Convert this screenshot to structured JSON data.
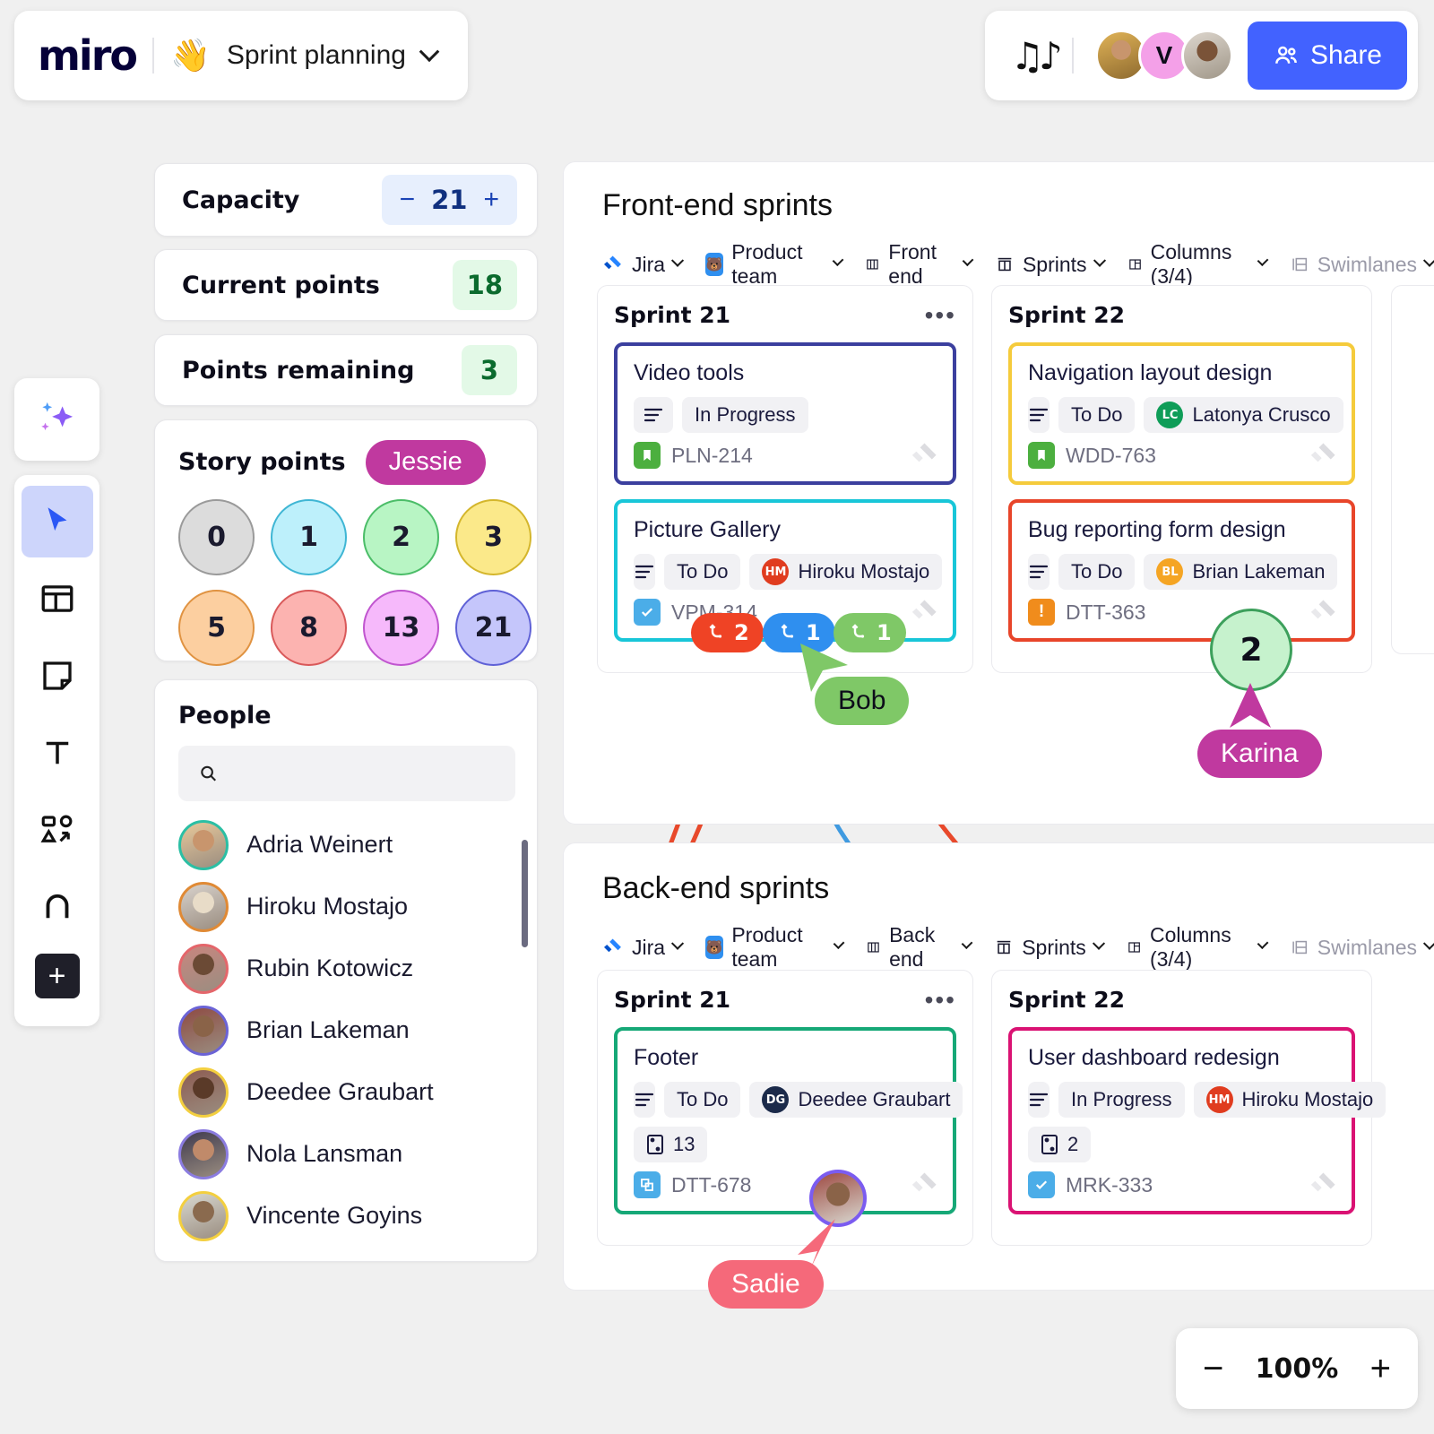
{
  "header": {
    "logo": "miro",
    "wave_icon": "waving-hand-icon",
    "board_title": "Sprint planning",
    "chevron_icon": "chevron-down-icon",
    "music_icon": "music-notes-icon",
    "avatar_initial": "V",
    "share_label": "Share",
    "share_icon": "people-icon",
    "share_color": "#4262ff"
  },
  "toolbar": {
    "ai_icon": "sparkle-icon",
    "tools": [
      {
        "name": "select-tool",
        "icon": "cursor-icon",
        "active": true
      },
      {
        "name": "templates-tool",
        "icon": "layout-icon",
        "active": false
      },
      {
        "name": "sticky-note-tool",
        "icon": "sticky-note-icon",
        "active": false
      },
      {
        "name": "text-tool",
        "icon": "text-t-icon",
        "active": false
      },
      {
        "name": "shapes-tool",
        "icon": "shapes-icon",
        "active": false
      },
      {
        "name": "pen-tool",
        "icon": "pen-icon",
        "active": false
      }
    ],
    "add_label": "+",
    "add_icon": "plus-icon"
  },
  "sidebar": {
    "capacity": {
      "label": "Capacity",
      "value": "21",
      "minus": "−",
      "plus": "+"
    },
    "current_points": {
      "label": "Current points",
      "value": "18"
    },
    "points_remaining": {
      "label": "Points remaining",
      "value": "3"
    },
    "story_points": {
      "title": "Story points",
      "cursor_name": "Jessie",
      "cursor_color": "#c0399f",
      "values": [
        {
          "value": "0",
          "fill": "#dcdcdc",
          "stroke": "#9a9a9a"
        },
        {
          "value": "1",
          "fill": "#bdf0fb",
          "stroke": "#3fb6d4"
        },
        {
          "value": "2",
          "fill": "#b8f5c4",
          "stroke": "#4bbd68"
        },
        {
          "value": "3",
          "fill": "#fbe98a",
          "stroke": "#d4b62c"
        },
        {
          "value": "5",
          "fill": "#fccfa0",
          "stroke": "#e09342"
        },
        {
          "value": "8",
          "fill": "#fcb3b0",
          "stroke": "#d9595a"
        },
        {
          "value": "13",
          "fill": "#f6b9fb",
          "stroke": "#c055cf"
        },
        {
          "value": "21",
          "fill": "#c5c6fb",
          "stroke": "#5f61d6"
        }
      ]
    },
    "people": {
      "title": "People",
      "search_placeholder": "",
      "search_value": "",
      "search_icon": "search-icon",
      "list": [
        {
          "name": "Adria Weinert",
          "ring": "#2bbfa4",
          "skin": "#c8956d",
          "bg": "#e8c89a"
        },
        {
          "name": "Hiroku Mostajo",
          "ring": "#e08a35",
          "skin": "#e8dcc8",
          "bg": "#d8d2cc"
        },
        {
          "name": "Rubin Kotowicz",
          "ring": "#e4666b",
          "skin": "#6b4a35",
          "bg": "#c9867f"
        },
        {
          "name": "Brian Lakeman",
          "ring": "#6b63d6",
          "skin": "#8a6348",
          "bg": "#8e4a42"
        },
        {
          "name": "Deedee Graubart",
          "ring": "#f3cf3f",
          "skin": "#5a3a28",
          "bg": "#8d5c52"
        },
        {
          "name": "Nola Lansman",
          "ring": "#8b7ce0",
          "skin": "#c08a6a",
          "bg": "#3f3a4e"
        },
        {
          "name": "Vincente Goyins",
          "ring": "#f3cf3f",
          "skin": "#8a6a4e",
          "bg": "#d8d8d0"
        }
      ]
    }
  },
  "canvas": {
    "frames": [
      {
        "title": "Front-end sprints",
        "filters": [
          {
            "label": "Jira",
            "icon": "jira-icon",
            "muted": false
          },
          {
            "label": "Product team",
            "icon": "team-icon",
            "muted": false
          },
          {
            "label": "Front end",
            "icon": "board-icon",
            "muted": false
          },
          {
            "label": "Sprints",
            "icon": "sprints-icon",
            "muted": false
          },
          {
            "label": "Columns (3/4)",
            "icon": "columns-icon",
            "muted": false
          },
          {
            "label": "Swimlanes",
            "icon": "swimlanes-icon",
            "muted": true
          }
        ],
        "columns": [
          {
            "title": "Sprint 21",
            "menu_icon": "more-icon",
            "cards": [
              {
                "title": "Video tools",
                "border": "#3b3f9e",
                "status": "In Progress",
                "assignee": null,
                "assignee_initials": null,
                "assignee_color": null,
                "points": null,
                "key": "PLN-214",
                "key_icon": "story-bookmark-icon",
                "key_color": "#4caf3f"
              },
              {
                "title": "Picture Gallery",
                "border": "#18c6d8",
                "status": "To Do",
                "assignee": "Hiroku Mostajo",
                "assignee_initials": "HM",
                "assignee_color": "#e03c1f",
                "points": null,
                "key": "VPM-314",
                "key_icon": "task-check-icon",
                "key_color": "#4bade8"
              }
            ]
          },
          {
            "title": "Sprint 22",
            "menu_icon": "more-icon",
            "cards": [
              {
                "title": "Navigation layout design",
                "border": "#f5cb3c",
                "status": "To Do",
                "assignee": "Latonya Crusco",
                "assignee_initials": "LC",
                "assignee_color": "#0f9d58",
                "points": null,
                "key": "WDD-763",
                "key_icon": "story-bookmark-icon",
                "key_color": "#4caf3f"
              },
              {
                "title": "Bug reporting form design",
                "border": "#e8452a",
                "status": "To Do",
                "assignee": "Brian Lakeman",
                "assignee_initials": "BL",
                "assignee_color": "#f5a524",
                "points": null,
                "key": "DTT-363",
                "key_icon": "bug-alert-icon",
                "key_color": "#f08c1c"
              }
            ]
          }
        ]
      },
      {
        "title": "Back-end sprints",
        "filters": [
          {
            "label": "Jira",
            "icon": "jira-icon",
            "muted": false
          },
          {
            "label": "Product team",
            "icon": "team-icon",
            "muted": false
          },
          {
            "label": "Back end",
            "icon": "board-icon",
            "muted": false
          },
          {
            "label": "Sprints",
            "icon": "sprints-icon",
            "muted": false
          },
          {
            "label": "Columns (3/4)",
            "icon": "columns-icon",
            "muted": false
          },
          {
            "label": "Swimlanes",
            "icon": "swimlanes-icon",
            "muted": true
          }
        ],
        "columns": [
          {
            "title": "Sprint 21",
            "menu_icon": "more-icon",
            "cards": [
              {
                "title": "Footer",
                "border": "#16a877",
                "status": "To Do",
                "assignee": "Deedee Graubart",
                "assignee_initials": "DG",
                "assignee_color": "#1b2a4a",
                "points": "13",
                "key": "DTT-678",
                "key_icon": "subtask-icon",
                "key_color": "#4bade8"
              }
            ]
          },
          {
            "title": "Sprint 22",
            "menu_icon": "more-icon",
            "cards": [
              {
                "title": "User dashboard redesign",
                "border": "#da1273",
                "status": "In Progress",
                "assignee": "Hiroku Mostajo",
                "assignee_initials": "HM",
                "assignee_color": "#e03c1f",
                "points": "2",
                "key": "MRK-333",
                "key_icon": "task-check-icon",
                "key_color": "#4bade8"
              }
            ]
          }
        ]
      }
    ],
    "connection_badges": [
      {
        "count": "2",
        "color": "#ef4325",
        "icon": "connector-icon"
      },
      {
        "count": "1",
        "color": "#2f8fef",
        "icon": "connector-icon"
      },
      {
        "count": "1",
        "color": "#7fc867",
        "icon": "connector-icon"
      }
    ],
    "vote_bubble": {
      "value": "2",
      "fill": "#c6f2cd",
      "stroke": "#3da05c"
    },
    "cursors": [
      {
        "name": "Bob",
        "color": "#7fc867",
        "text": "#0d0d1a"
      },
      {
        "name": "Karina",
        "color": "#c0399f",
        "text": "#ffffff"
      },
      {
        "name": "Sadie",
        "color": "#f5697a",
        "text": "#ffffff"
      }
    ]
  },
  "zoom": {
    "minus": "−",
    "value": "100%",
    "plus": "+"
  }
}
